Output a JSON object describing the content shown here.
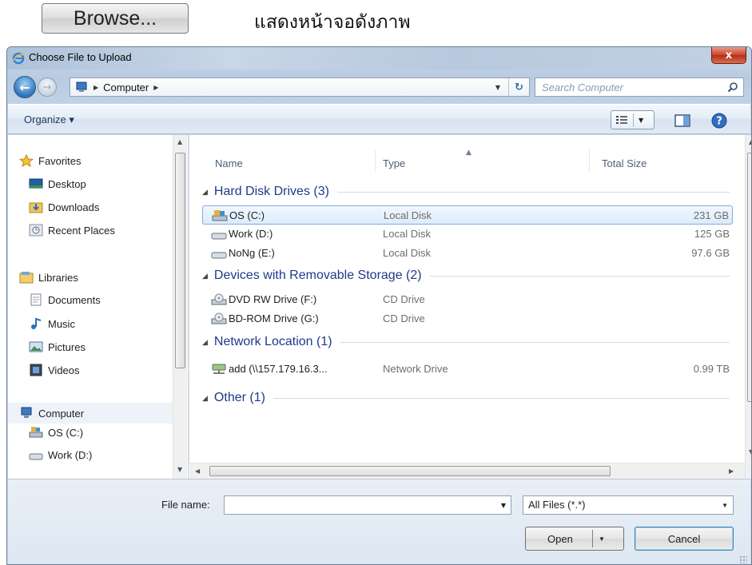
{
  "top": {
    "browse_label": "Browse...",
    "caption": "แสดงหน้าจอดังภาพ"
  },
  "dialog": {
    "title": "Choose File to Upload",
    "close_label": "x",
    "address": {
      "segments": [
        "Computer"
      ]
    },
    "search_placeholder": "Search Computer",
    "organize_label": "Organize ▾"
  },
  "nav": {
    "favorites": "Favorites",
    "desktop": "Desktop",
    "downloads": "Downloads",
    "recent": "Recent Places",
    "libraries": "Libraries",
    "documents": "Documents",
    "music": "Music",
    "pictures": "Pictures",
    "videos": "Videos",
    "computer": "Computer",
    "os": "OS (C:)",
    "work": "Work (D:)"
  },
  "columns": {
    "name": "Name",
    "type": "Type",
    "total_size": "Total Size"
  },
  "groups": {
    "hdd": "Hard Disk Drives (3)",
    "removable": "Devices with Removable Storage (2)",
    "network": "Network Location (1)",
    "other": "Other (1)"
  },
  "rows": [
    {
      "name": "OS (C:)",
      "type": "Local Disk",
      "size": "231 GB"
    },
    {
      "name": "Work (D:)",
      "type": "Local Disk",
      "size": "125 GB"
    },
    {
      "name": "NoNg (E:)",
      "type": "Local Disk",
      "size": "97.6 GB"
    },
    {
      "name": "DVD RW Drive (F:)",
      "type": "CD Drive",
      "size": ""
    },
    {
      "name": "BD-ROM Drive (G:)",
      "type": "CD Drive",
      "size": ""
    },
    {
      "name": "add (\\\\157.179.16.3...",
      "type": "Network Drive",
      "size": "0.99 TB"
    }
  ],
  "bottom": {
    "file_name_label": "File name:",
    "file_name_value": "",
    "filter_label": "All Files (*.*)",
    "open_label": "Open",
    "cancel_label": "Cancel"
  },
  "colors": {
    "group_header": "#1e3a8a",
    "selection": "#dcebfc",
    "close_button": "#c8442c"
  }
}
